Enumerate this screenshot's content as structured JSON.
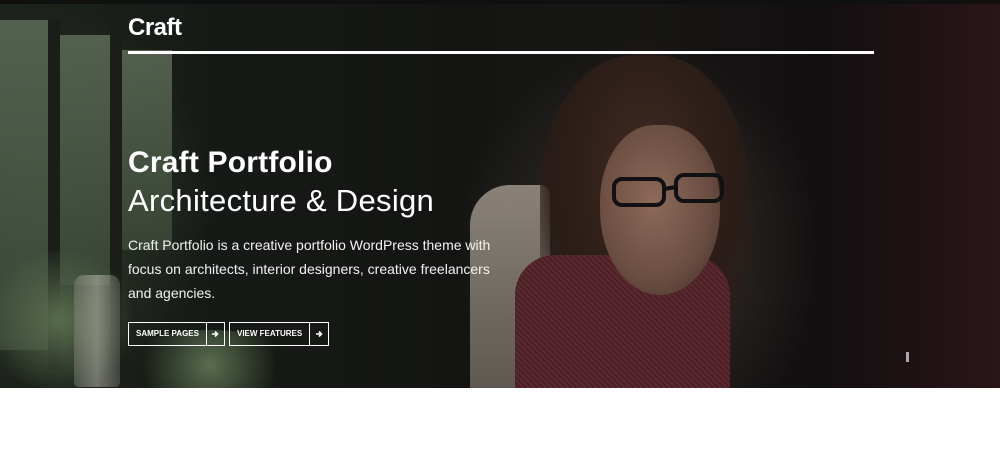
{
  "header": {
    "brand": "Craft"
  },
  "hero": {
    "title": "Craft Portfolio",
    "subtitle": "Architecture & Design",
    "description": "Craft Portfolio is a creative portfolio WordPress theme with focus on architects, interior designers, creative freelancers and agencies.",
    "buttons": [
      {
        "label": "SAMPLE PAGES",
        "icon": "arrow-right-icon"
      },
      {
        "label": "VIEW FEATURES",
        "icon": "arrow-right-icon"
      }
    ]
  },
  "colors": {
    "text": "#ffffff",
    "page_background": "#ffffff",
    "hero_background": "#161a16"
  }
}
